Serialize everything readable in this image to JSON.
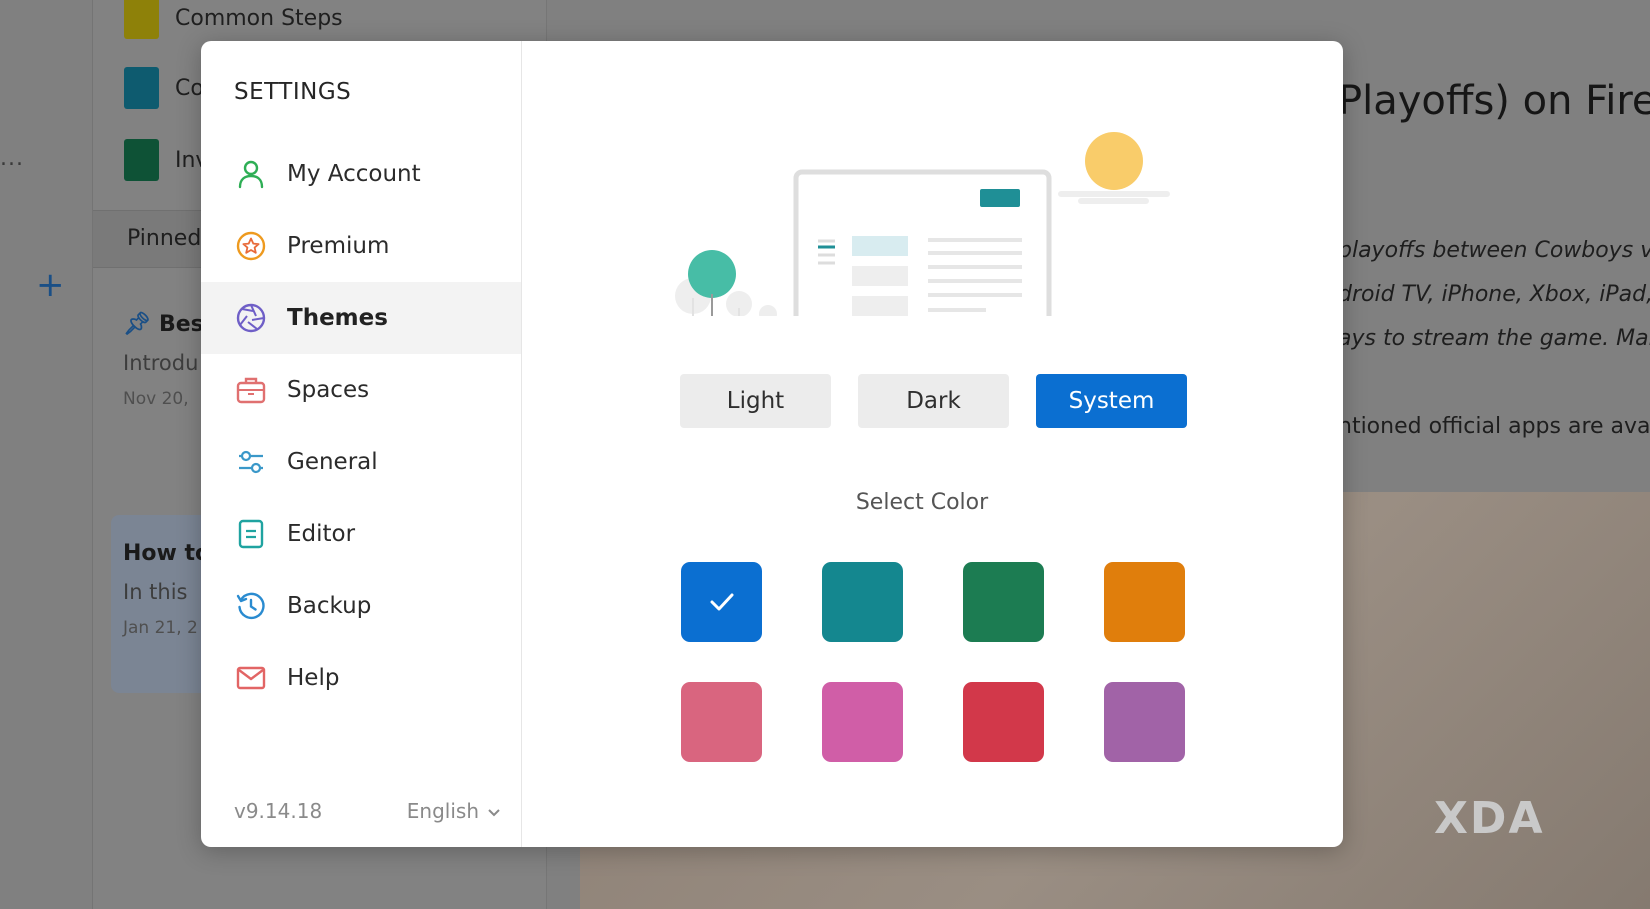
{
  "background": {
    "notebooks": [
      {
        "label": "Common Steps",
        "color": "#8e8109"
      },
      {
        "label": "Co",
        "color": "#0e5b6f"
      },
      {
        "label": "Inv",
        "color": "#0e5236"
      }
    ],
    "pinned_label": "Pinned",
    "note1": {
      "title": "Bes",
      "preview": "Introdu",
      "date": "Nov 20,"
    },
    "note2": {
      "title": "How to",
      "preview": "In this",
      "date": "Jan 21, 2"
    },
    "dots": "...",
    "article_title": "Playoffs) on Fire",
    "article_lines": [
      "playoffs between Cowboys v",
      "droid TV, iPhone, Xbox, iPad, a",
      "ays to stream the game. Mak",
      "ntioned official apps are avai"
    ],
    "watermark": "XDA"
  },
  "settings": {
    "title": "SETTINGS",
    "nav": [
      {
        "label": "My Account",
        "icon": "user-icon",
        "color": "#2eae55"
      },
      {
        "label": "Premium",
        "icon": "star-badge-icon",
        "color": "#ee9a1f"
      },
      {
        "label": "Themes",
        "icon": "aperture-icon",
        "color": "#6f5fc7",
        "active": true
      },
      {
        "label": "Spaces",
        "icon": "briefcase-icon",
        "color": "#e07070"
      },
      {
        "label": "General",
        "icon": "sliders-icon",
        "color": "#3a98c9"
      },
      {
        "label": "Editor",
        "icon": "document-icon",
        "color": "#1fa3a0"
      },
      {
        "label": "Backup",
        "icon": "history-icon",
        "color": "#2a8bd0"
      },
      {
        "label": "Help",
        "icon": "mail-icon",
        "color": "#e26565"
      }
    ],
    "version": "v9.14.18",
    "language": "English",
    "modes": [
      {
        "label": "Light",
        "selected": false
      },
      {
        "label": "Dark",
        "selected": false
      },
      {
        "label": "System",
        "selected": true
      }
    ],
    "select_color_label": "Select Color",
    "colors": [
      {
        "hex": "#0b6fd1",
        "selected": true
      },
      {
        "hex": "#14878f"
      },
      {
        "hex": "#1c7c52"
      },
      {
        "hex": "#e07e0c"
      },
      {
        "hex": "#d9657f"
      },
      {
        "hex": "#d05ea7"
      },
      {
        "hex": "#d2384a"
      },
      {
        "hex": "#a163a7"
      }
    ]
  }
}
